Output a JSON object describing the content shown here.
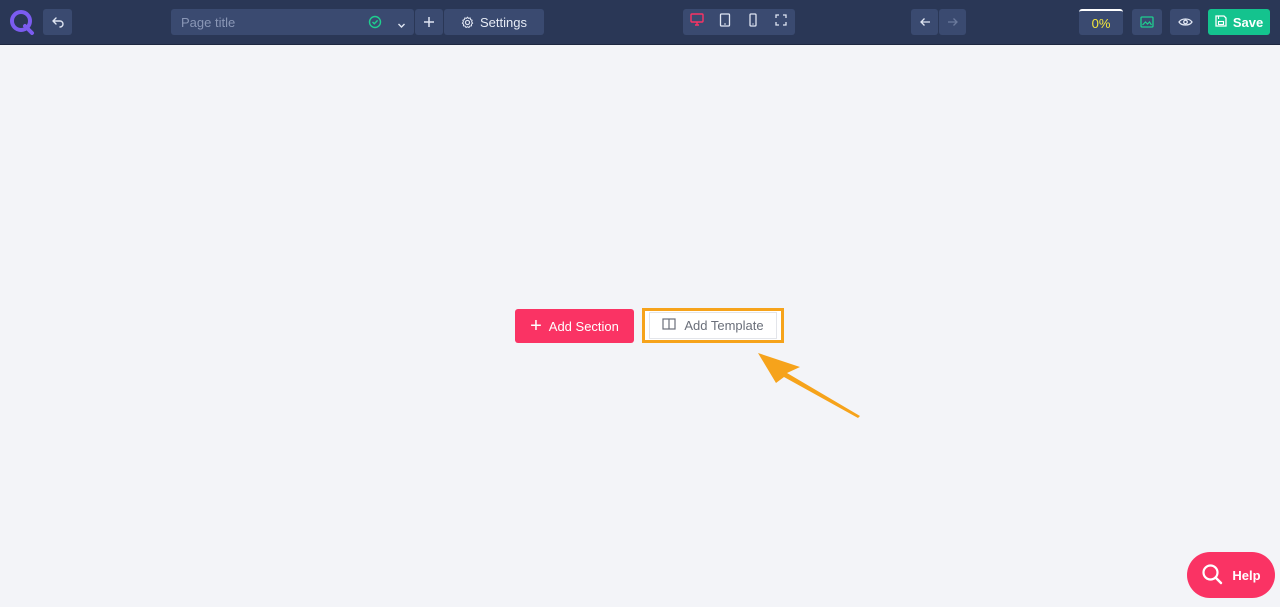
{
  "toolbar": {
    "title_placeholder": "Page title",
    "settings_label": "Settings",
    "progress": "0%",
    "save_label": "Save",
    "icons": {
      "logo": "q-logo-icon",
      "back": "undo-back-icon",
      "title_status": "check-circle-icon",
      "dropdown": "chevron-down-icon",
      "add": "plus-icon",
      "settings": "gear-icon",
      "desktop": "desktop-icon",
      "tablet": "tablet-icon",
      "mobile": "mobile-icon",
      "fullscreen": "fullscreen-icon",
      "undo": "arrow-left-icon",
      "redo": "arrow-right-icon",
      "media": "image-icon",
      "preview": "eye-icon",
      "save": "floppy-icon"
    }
  },
  "canvas": {
    "add_section_label": "Add Section",
    "add_template_label": "Add Template"
  },
  "help": {
    "label": "Help"
  },
  "colors": {
    "topbar": "#2a3756",
    "accent_pink": "#fa3364",
    "save_green": "#14c38e",
    "highlight_orange": "#f6a31b",
    "progress_yellow": "#f3e73c"
  }
}
